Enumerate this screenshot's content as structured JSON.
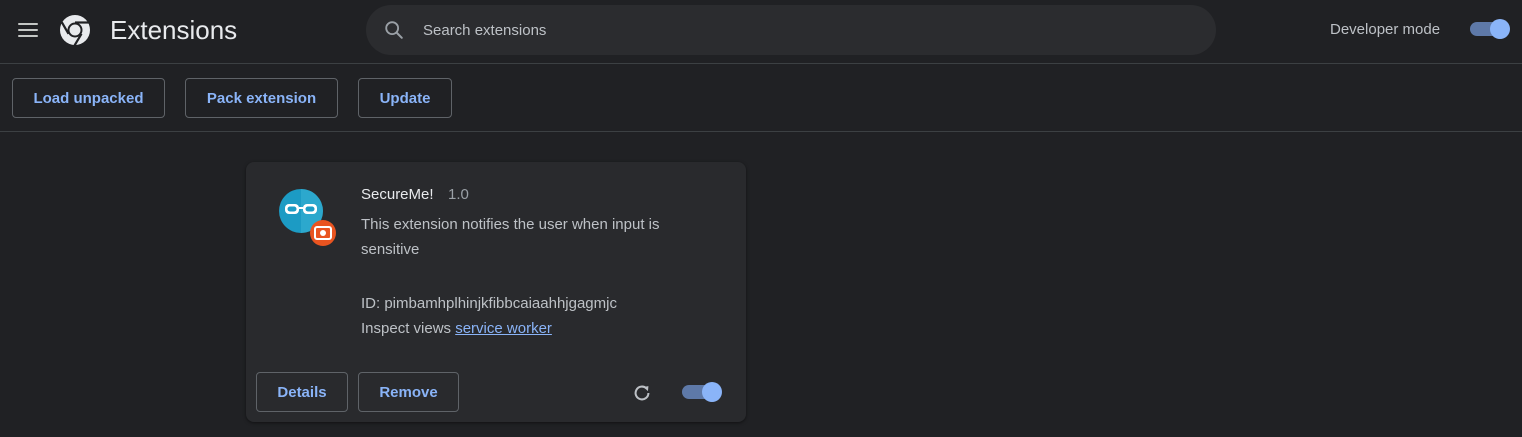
{
  "header": {
    "title": "Extensions",
    "menu_icon": "hamburger-menu-icon",
    "logo_icon": "chrome-logo-icon",
    "search": {
      "placeholder": "Search extensions",
      "value": "",
      "icon": "search-icon"
    },
    "developer_mode": {
      "label": "Developer mode",
      "enabled": true
    }
  },
  "toolbar": {
    "load_unpacked": "Load unpacked",
    "pack_extension": "Pack extension",
    "update": "Update"
  },
  "extension": {
    "name": "SecureMe!",
    "version": "1.0",
    "description": "This extension notifies the user when input is sensitive",
    "id_line": "ID: pimbamhplhinjkfibbcaiaahhjgagmjc",
    "inspect_label": "Inspect views",
    "inspect_link": "service worker",
    "details_label": "Details",
    "remove_label": "Remove",
    "enabled": true,
    "icon": "glasses-icon",
    "badge_icon": "unpacked-badge-icon",
    "reload_icon": "reload-icon"
  },
  "colors": {
    "background": "#202124",
    "card": "#292a2d",
    "accent": "#8ab4f8",
    "icon_teal": "#1c9bc4",
    "badge_orange": "#e95420"
  }
}
